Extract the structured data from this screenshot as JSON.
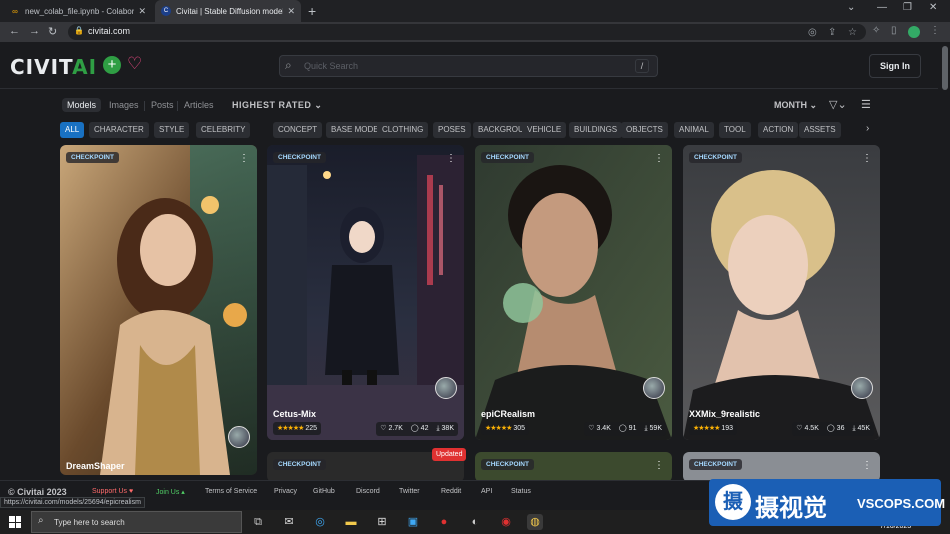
{
  "browser": {
    "tabs": [
      {
        "title": "new_colab_file.ipynb - Colaborat",
        "icon": "colab-icon"
      },
      {
        "title": "Civitai | Stable Diffusion models",
        "icon": "civitai-icon"
      }
    ],
    "url": "civitai.com",
    "status_url": "https://civitai.com/models/25694/epicrealism"
  },
  "header": {
    "logo_main": "CIVIT",
    "logo_ai": "AI",
    "search_placeholder": "Quick Search",
    "search_shortcut": "/",
    "signin_label": "Sign In"
  },
  "toolbar": {
    "view_tabs": [
      "Models",
      "Images",
      "Posts",
      "Articles"
    ],
    "selected_view": "Models",
    "sort": "HIGHEST RATED",
    "period": "MONTH"
  },
  "tags": [
    "ALL",
    "CHARACTER",
    "STYLE",
    "CELEBRITY",
    "CONCEPT",
    "BASE MODEL",
    "CLOTHING",
    "POSES",
    "BACKGROUND",
    "VEHICLE",
    "BUILDINGS",
    "OBJECTS",
    "ANIMAL",
    "TOOL",
    "ACTION",
    "ASSETS"
  ],
  "selected_tag": "ALL",
  "cards": [
    {
      "badge": "CHECKPOINT",
      "name": "DreamShaper"
    },
    {
      "badge": "CHECKPOINT",
      "name": "Cetus-Mix",
      "rating_count": "225",
      "likes": "2.7K",
      "comments": "42",
      "downloads": "38K"
    },
    {
      "badge": "CHECKPOINT",
      "name": "epiCRealism",
      "rating_count": "305",
      "likes": "3.4K",
      "comments": "91",
      "downloads": "59K"
    },
    {
      "badge": "CHECKPOINT",
      "name": "XXMix_9realistic",
      "rating_count": "193",
      "likes": "4.5K",
      "comments": "36",
      "downloads": "45K"
    }
  ],
  "second_row": [
    {
      "badge": "CHECKPOINT",
      "flag": "Updated"
    },
    {
      "badge": "CHECKPOINT"
    },
    {
      "badge": "CHECKPOINT"
    }
  ],
  "stars": "★★★★★",
  "footer": {
    "copyright": "© Civitai 2023",
    "links": [
      "Support Us",
      "Join Us",
      "Terms of Service",
      "Privacy",
      "GitHub",
      "Discord",
      "Twitter",
      "Reddit",
      "API",
      "Status"
    ]
  },
  "taskbar": {
    "search_placeholder": "Type here to search",
    "date": "7/16/2023"
  },
  "watermark": {
    "cn": "摄视觉",
    "en": "VSCOPS.COM",
    "mark": "摄"
  }
}
